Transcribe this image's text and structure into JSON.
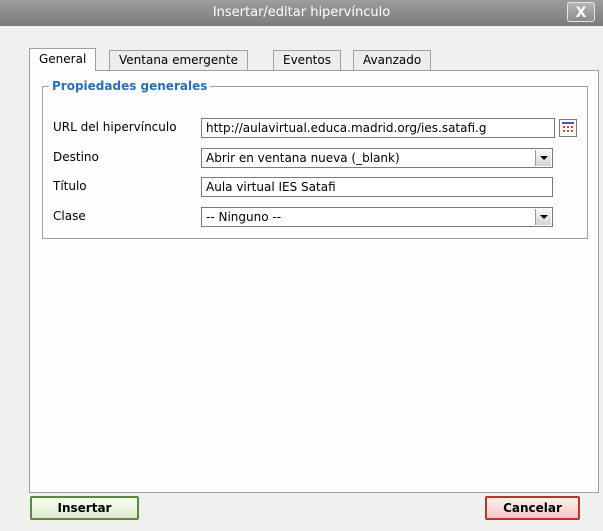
{
  "dialog": {
    "title": "Insertar/editar hipervínculo",
    "close_label": "X"
  },
  "tabs": [
    {
      "label": "General",
      "active": true
    },
    {
      "label": "Ventana emergente",
      "active": false
    },
    {
      "label": "Eventos",
      "active": false
    },
    {
      "label": "Avanzado",
      "active": false
    }
  ],
  "fieldset": {
    "legend": "Propiedades generales"
  },
  "form": {
    "url": {
      "label": "URL del hipervínculo",
      "value": "http://aulavirtual.educa.madrid.org/ies.satafi.g"
    },
    "target": {
      "label": "Destino",
      "value": "Abrir en ventana nueva (_blank)"
    },
    "title": {
      "label": "Título",
      "value": "Aula virtual IES Satafi"
    },
    "class": {
      "label": "Clase",
      "value": "-- Ninguno --"
    }
  },
  "buttons": {
    "insert_label": "Insertar",
    "cancel_label": "Cancelar"
  },
  "colors": {
    "legend": "#2b6fb6",
    "insert_border": "#5d8a3a",
    "cancel_border": "#b8352a"
  },
  "icons": {
    "browse": "browse-list-icon",
    "select_arrow": "chevron-down-icon",
    "close": "close-icon"
  }
}
